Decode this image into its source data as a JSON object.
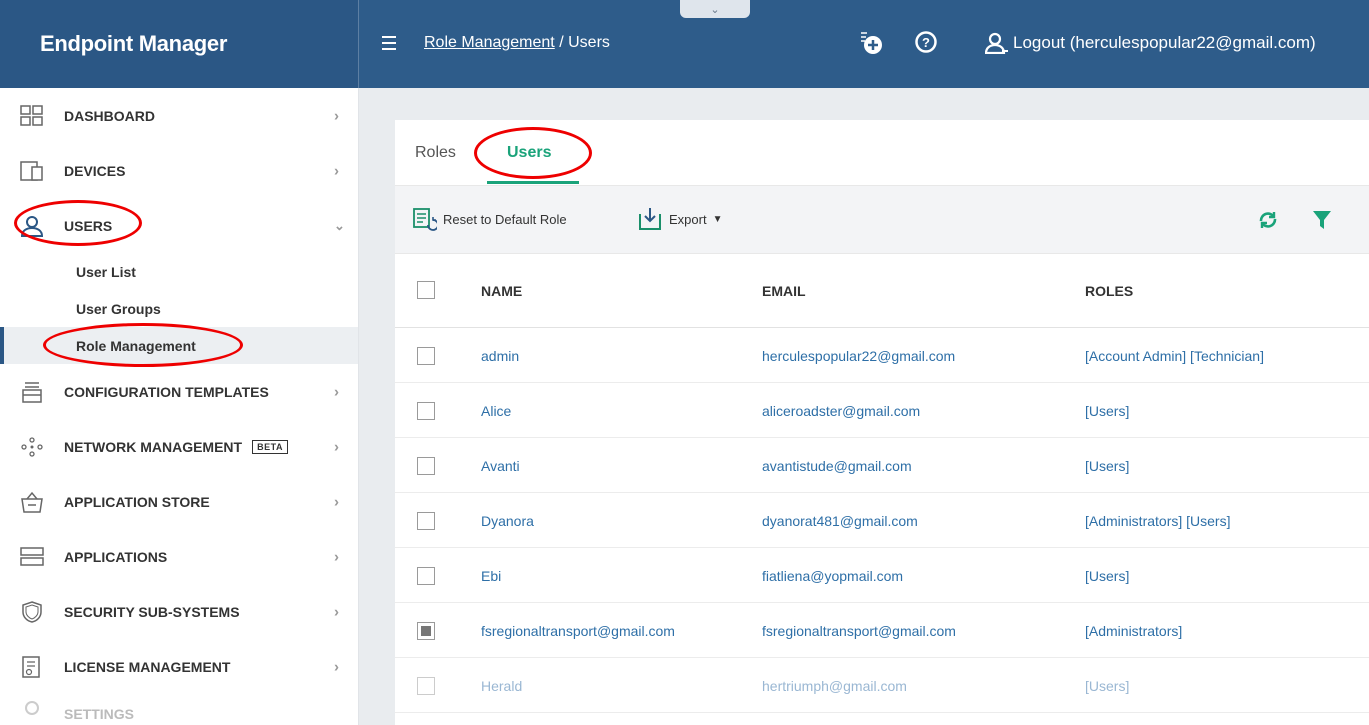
{
  "app": {
    "title": "Endpoint Manager"
  },
  "header": {
    "breadcrumb_link": "Role Management",
    "breadcrumb_sep": "/",
    "breadcrumb_current": "Users",
    "logout_label": "Logout (herculespopular22@gmail.com)"
  },
  "sidebar": {
    "items": [
      {
        "label": "DASHBOARD",
        "icon": "dashboard-icon"
      },
      {
        "label": "DEVICES",
        "icon": "devices-icon"
      },
      {
        "label": "USERS",
        "icon": "user-icon"
      },
      {
        "label": "CONFIGURATION TEMPLATES",
        "icon": "config-templates-icon"
      },
      {
        "label": "NETWORK MANAGEMENT",
        "icon": "network-icon",
        "badge": "BETA"
      },
      {
        "label": "APPLICATION STORE",
        "icon": "store-icon"
      },
      {
        "label": "APPLICATIONS",
        "icon": "applications-icon"
      },
      {
        "label": "SECURITY SUB-SYSTEMS",
        "icon": "shield-icon"
      },
      {
        "label": "LICENSE MANAGEMENT",
        "icon": "license-icon"
      },
      {
        "label": "SETTINGS",
        "icon": "settings-icon"
      }
    ],
    "users_sub": [
      "User List",
      "User Groups",
      "Role Management"
    ]
  },
  "tabs": {
    "roles": "Roles",
    "users": "Users"
  },
  "toolbar": {
    "reset": "Reset to Default Role",
    "export": "Export"
  },
  "table": {
    "headers": {
      "name": "NAME",
      "email": "EMAIL",
      "roles": "ROLES"
    },
    "rows": [
      {
        "name": "admin",
        "email": "herculespopular22@gmail.com",
        "roles": "[Account Admin] [Technician]"
      },
      {
        "name": "Alice",
        "email": "aliceroadster@gmail.com",
        "roles": "[Users]"
      },
      {
        "name": "Avanti",
        "email": "avantistude@gmail.com",
        "roles": "[Users]"
      },
      {
        "name": "Dyanora",
        "email": "dyanorat481@gmail.com",
        "roles": "[Administrators] [Users]"
      },
      {
        "name": "Ebi",
        "email": "fiatliena@yopmail.com",
        "roles": "[Users]"
      },
      {
        "name": "fsregionaltransport@gmail.com",
        "email": "fsregionaltransport@gmail.com",
        "roles": "[Administrators]"
      },
      {
        "name": "Herald",
        "email": "hertriumph@gmail.com",
        "roles": "[Users]"
      }
    ]
  },
  "colors": {
    "brand": "#2b5785",
    "accent": "#1aa37a",
    "link": "#2e6fa7",
    "annotation": "#ee0000"
  }
}
